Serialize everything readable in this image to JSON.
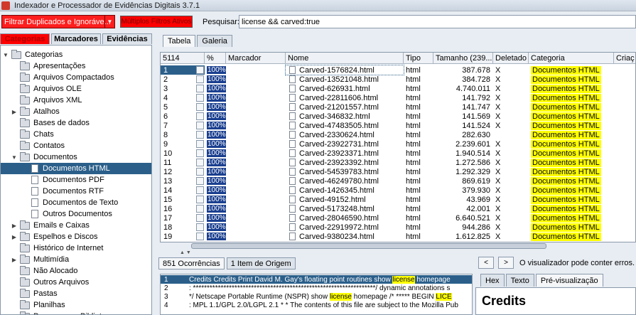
{
  "window": {
    "title": "Indexador e Processador de Evidências Digitais 3.7.1"
  },
  "toolbar": {
    "duplicates_filter": "Filtrar Duplicados e Ignoráve...",
    "multi_filters": "Múltiplos Filtros Ativos",
    "search_label": "Pesquisar:",
    "search_value": "license && carved:true"
  },
  "left_tabs": [
    "Categorias",
    "Marcadores",
    "Evidências"
  ],
  "tree": {
    "root": "Categorias",
    "items": [
      {
        "label": "Apresentações",
        "expandable": false
      },
      {
        "label": "Arquivos Compactados",
        "expandable": false
      },
      {
        "label": "Arquivos OLE",
        "expandable": false
      },
      {
        "label": "Arquivos XML",
        "expandable": false
      },
      {
        "label": "Atalhos",
        "expandable": true
      },
      {
        "label": "Bases de dados",
        "expandable": false
      },
      {
        "label": "Chats",
        "expandable": false
      },
      {
        "label": "Contatos",
        "expandable": false
      },
      {
        "label": "Documentos",
        "expandable": true,
        "expanded": true
      },
      {
        "label": "Documentos HTML",
        "child": true,
        "selected": true
      },
      {
        "label": "Documentos PDF",
        "child": true
      },
      {
        "label": "Documentos RTF",
        "child": true
      },
      {
        "label": "Documentos de Texto",
        "child": true
      },
      {
        "label": "Outros Documentos",
        "child": true
      },
      {
        "label": "Emails e Caixas",
        "expandable": true
      },
      {
        "label": "Espelhos e Discos",
        "expandable": true
      },
      {
        "label": "Histórico de Internet",
        "expandable": false
      },
      {
        "label": "Multimídia",
        "expandable": true
      },
      {
        "label": "Não Alocado",
        "expandable": false
      },
      {
        "label": "Outros Arquivos",
        "expandable": false
      },
      {
        "label": "Pastas",
        "expandable": false
      },
      {
        "label": "Planilhas",
        "expandable": false
      },
      {
        "label": "Programas e Bibliotecas",
        "expandable": false
      }
    ]
  },
  "result_tabs": [
    "Tabela",
    "Galeria"
  ],
  "table": {
    "columns": [
      "5114",
      "%",
      "Marcador",
      "Nome",
      "Tipo",
      "Tamanho (239...",
      "Deletado",
      "Categoria",
      "Criaç"
    ],
    "rows": [
      {
        "n": "1",
        "pct": "100%",
        "name": "Carved-1576824.html",
        "type": "html",
        "size": "387.678",
        "deleted": "X",
        "category": "Documentos HTML"
      },
      {
        "n": "2",
        "pct": "100%",
        "name": "Carved-13521048.html",
        "type": "html",
        "size": "384.728",
        "deleted": "X",
        "category": "Documentos HTML"
      },
      {
        "n": "3",
        "pct": "100%",
        "name": "Carved-626931.html",
        "type": "html",
        "size": "4.740.011",
        "deleted": "X",
        "category": "Documentos HTML"
      },
      {
        "n": "4",
        "pct": "100%",
        "name": "Carved-22811606.html",
        "type": "html",
        "size": "141.792",
        "deleted": "X",
        "category": "Documentos HTML"
      },
      {
        "n": "5",
        "pct": "100%",
        "name": "Carved-21201557.html",
        "type": "html",
        "size": "141.747",
        "deleted": "X",
        "category": "Documentos HTML"
      },
      {
        "n": "6",
        "pct": "100%",
        "name": "Carved-346832.html",
        "type": "html",
        "size": "141.569",
        "deleted": "X",
        "category": "Documentos HTML"
      },
      {
        "n": "7",
        "pct": "100%",
        "name": "Carved-47483505.html",
        "type": "html",
        "size": "141.524",
        "deleted": "X",
        "category": "Documentos HTML"
      },
      {
        "n": "8",
        "pct": "100%",
        "name": "Carved-2330624.html",
        "type": "html",
        "size": "282.630",
        "deleted": "",
        "category": "Documentos HTML"
      },
      {
        "n": "9",
        "pct": "100%",
        "name": "Carved-23922731.html",
        "type": "html",
        "size": "2.239.601",
        "deleted": "X",
        "category": "Documentos HTML"
      },
      {
        "n": "10",
        "pct": "100%",
        "name": "Carved-23923371.html",
        "type": "html",
        "size": "1.940.514",
        "deleted": "X",
        "category": "Documentos HTML"
      },
      {
        "n": "11",
        "pct": "100%",
        "name": "Carved-23923392.html",
        "type": "html",
        "size": "1.272.586",
        "deleted": "X",
        "category": "Documentos HTML"
      },
      {
        "n": "12",
        "pct": "100%",
        "name": "Carved-54539783.html",
        "type": "html",
        "size": "1.292.329",
        "deleted": "X",
        "category": "Documentos HTML"
      },
      {
        "n": "13",
        "pct": "100%",
        "name": "Carved-46249780.html",
        "type": "html",
        "size": "869.619",
        "deleted": "X",
        "category": "Documentos HTML"
      },
      {
        "n": "14",
        "pct": "100%",
        "name": "Carved-1426345.html",
        "type": "html",
        "size": "379.930",
        "deleted": "X",
        "category": "Documentos HTML"
      },
      {
        "n": "15",
        "pct": "100%",
        "name": "Carved-49152.html",
        "type": "html",
        "size": "43.969",
        "deleted": "X",
        "category": "Documentos HTML"
      },
      {
        "n": "16",
        "pct": "100%",
        "name": "Carved-5173248.html",
        "type": "html",
        "size": "42.001",
        "deleted": "X",
        "category": "Documentos HTML"
      },
      {
        "n": "17",
        "pct": "100%",
        "name": "Carved-28046590.html",
        "type": "html",
        "size": "6.640.521",
        "deleted": "X",
        "category": "Documentos HTML"
      },
      {
        "n": "18",
        "pct": "100%",
        "name": "Carved-22919972.html",
        "type": "html",
        "size": "944.286",
        "deleted": "X",
        "category": "Documentos HTML"
      },
      {
        "n": "19",
        "pct": "100%",
        "name": "Carved-9380234.html",
        "type": "html",
        "size": "1.612.825",
        "deleted": "X",
        "category": "Documentos HTML"
      }
    ]
  },
  "bottom_tabs": [
    "851 Ocorrências",
    "1 Item de Origem"
  ],
  "hits": [
    {
      "n": "1",
      "before": "Credits Credits Print David M. Gay's floating point routines show ",
      "hit": "license",
      "after": " homepage"
    },
    {
      "n": "2",
      "before": ": ******************************************************************/ dynamic annotations s",
      "hit": "",
      "after": ""
    },
    {
      "n": "3",
      "before": "*/ Netscape Portable Runtime (NSPR) show ",
      "hit": "license",
      "after": " homepage /* ***** BEGIN ",
      "hit2": "LICE"
    },
    {
      "n": "4",
      "before": ": MPL 1.1/GPL 2.0/LGPL 2.1 * * The contents of this file are subject to the Mozilla Pub",
      "hit": "",
      "after": ""
    }
  ],
  "viewer": {
    "prev": "<",
    "next": ">",
    "warning": "O visualizador pode conter erros. Cl",
    "tabs": [
      "Hex",
      "Texto",
      "Pré-visualização"
    ],
    "heading": "Credits"
  },
  "colors": {
    "selection": "#2b5f8a",
    "highlight": "#ffff00",
    "alert": "#ff0000"
  }
}
